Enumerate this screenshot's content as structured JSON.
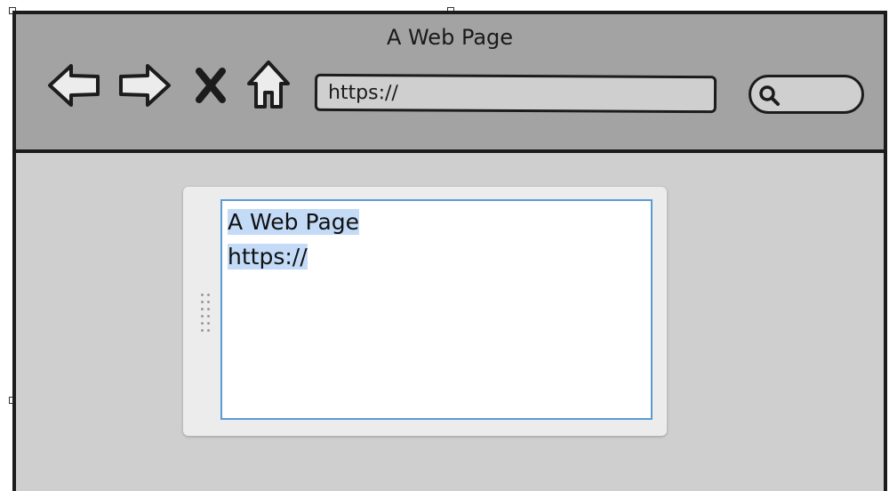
{
  "window": {
    "title": "A Web Page"
  },
  "address_bar": {
    "value": "https://"
  },
  "editor": {
    "lines": [
      "A Web Page",
      "https://"
    ]
  }
}
